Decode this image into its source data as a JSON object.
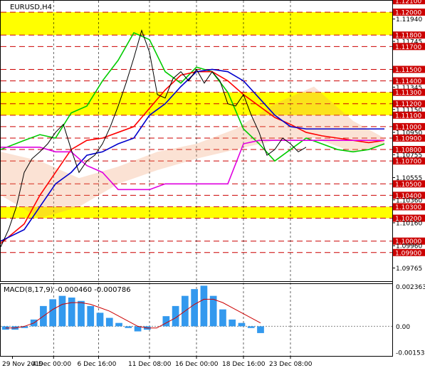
{
  "chart_data": [
    {
      "type": "line",
      "title": "EURUSD,H4",
      "ylim": [
        1.0965,
        1.121
      ],
      "y_ticks": [
        "1.12100",
        "1.12000",
        "1.11940",
        "1.11800",
        "1.11745",
        "1.11700",
        "1.11500",
        "1.11400",
        "1.11345",
        "1.11300",
        "1.11200",
        "1.11150",
        "1.11100",
        "1.11000",
        "1.10950",
        "1.10900",
        "1.10800",
        "1.10755",
        "1.10700",
        "1.10555",
        "1.10500",
        "1.10400",
        "1.10360",
        "1.10300",
        "1.10200",
        "1.10160",
        "1.10000",
        "1.09960",
        "1.09900",
        "1.09765"
      ],
      "highlighted_levels": [
        "1.12100",
        "1.12000",
        "1.11800",
        "1.11700",
        "1.11500",
        "1.11400",
        "1.11300",
        "1.11200",
        "1.11100",
        "1.11000",
        "1.10900",
        "1.10800",
        "1.10700",
        "1.10500",
        "1.10400",
        "1.10300",
        "1.10200",
        "1.10000",
        "1.09900"
      ],
      "yellow_zones": [
        [
          1.118,
          1.12
        ],
        [
          1.111,
          1.113
        ],
        [
          1.102,
          1.103
        ]
      ],
      "red_dashed_levels": [
        1.12,
        1.118,
        1.117,
        1.115,
        1.114,
        1.113,
        1.112,
        1.111,
        1.11,
        1.109,
        1.108,
        1.107,
        1.105,
        1.104,
        1.103,
        1.102,
        1.1,
        1.099
      ],
      "series": [
        {
          "color": "#00cc00",
          "x": [
            0,
            6,
            10,
            14,
            18,
            22,
            26,
            30,
            34,
            38,
            42,
            46,
            50,
            54,
            58,
            62,
            66,
            70,
            74,
            78,
            82,
            86,
            90,
            94,
            98
          ],
          "y": [
            1.108,
            1.1088,
            1.1093,
            1.109,
            1.1112,
            1.1118,
            1.114,
            1.1158,
            1.1182,
            1.1176,
            1.1148,
            1.1138,
            1.1152,
            1.1148,
            1.113,
            1.1098,
            1.1085,
            1.107,
            1.108,
            1.109,
            1.1085,
            1.108,
            1.1078,
            1.108,
            1.1085
          ]
        },
        {
          "color": "#ff0000",
          "x": [
            0,
            6,
            10,
            14,
            18,
            22,
            26,
            30,
            34,
            38,
            42,
            46,
            50,
            54,
            58,
            62,
            66,
            70,
            74,
            78,
            82,
            86,
            90,
            94,
            98
          ],
          "y": [
            1.0998,
            1.1015,
            1.104,
            1.106,
            1.108,
            1.1088,
            1.109,
            1.1095,
            1.11,
            1.1116,
            1.1132,
            1.1145,
            1.1148,
            1.1148,
            1.114,
            1.1128,
            1.1118,
            1.1108,
            1.1102,
            1.1095,
            1.1092,
            1.109,
            1.1088,
            1.1086,
            1.1088
          ]
        },
        {
          "color": "#0000cc",
          "x": [
            0,
            6,
            10,
            14,
            18,
            22,
            26,
            30,
            34,
            38,
            42,
            46,
            50,
            54,
            58,
            62,
            66,
            70,
            74,
            78,
            82,
            86,
            90,
            94,
            98
          ],
          "y": [
            1.1,
            1.101,
            1.103,
            1.105,
            1.106,
            1.1075,
            1.1078,
            1.1085,
            1.109,
            1.111,
            1.112,
            1.1135,
            1.1148,
            1.115,
            1.1148,
            1.114,
            1.1125,
            1.111,
            1.11,
            1.1098,
            1.1098,
            1.1098,
            1.1098,
            1.1098,
            1.1098
          ]
        },
        {
          "color": "#e000e0",
          "x": [
            0,
            6,
            10,
            14,
            18,
            22,
            26,
            30,
            34,
            38,
            42,
            46,
            50,
            54,
            58,
            62,
            66,
            70,
            74,
            78,
            82,
            86,
            90,
            94,
            98
          ],
          "y": [
            1.1082,
            1.1082,
            1.1082,
            1.1078,
            1.1078,
            1.1066,
            1.106,
            1.1045,
            1.1045,
            1.1045,
            1.105,
            1.105,
            1.105,
            1.105,
            1.105,
            1.1085,
            1.1088,
            1.1088,
            1.1088,
            1.1088,
            1.1088,
            1.1088,
            1.1088,
            1.1088,
            1.1088
          ]
        },
        {
          "color": "#000000",
          "x": [
            0,
            2,
            4,
            6,
            8,
            10,
            12,
            14,
            16,
            18,
            20,
            22,
            24,
            26,
            28,
            30,
            32,
            34,
            36,
            38,
            40,
            42,
            44,
            46,
            48,
            50,
            52,
            54,
            56,
            58,
            60,
            62,
            64,
            66,
            68,
            70,
            72,
            74,
            76,
            78
          ],
          "y": [
            1.0995,
            1.101,
            1.103,
            1.106,
            1.1072,
            1.1078,
            1.1085,
            1.1095,
            1.1102,
            1.108,
            1.106,
            1.107,
            1.1075,
            1.1085,
            1.11,
            1.1118,
            1.1138,
            1.116,
            1.1184,
            1.1165,
            1.1128,
            1.1125,
            1.1142,
            1.1148,
            1.114,
            1.115,
            1.1138,
            1.1148,
            1.114,
            1.112,
            1.1118,
            1.1128,
            1.111,
            1.1095,
            1.1075,
            1.108,
            1.109,
            1.1085,
            1.1078,
            1.1082
          ]
        }
      ]
    },
    {
      "type": "bar",
      "title": "MACD(8,17,9) -0.000460 -0.000786",
      "ylim": [
        -0.00175,
        0.0025
      ],
      "y_ticks": [
        "0.002363",
        "0.00",
        "-0.001538"
      ],
      "values": [
        -0.0002,
        -0.0002,
        -0.0001,
        0.0004,
        0.0012,
        0.0016,
        0.0018,
        0.0017,
        0.0015,
        0.0012,
        0.0008,
        0.0005,
        0.0002,
        -0.0001,
        -0.0003,
        -0.0002,
        0.0,
        0.0006,
        0.0012,
        0.0018,
        0.0022,
        0.0024,
        0.0018,
        0.001,
        0.0004,
        0.0002,
        -0.0001,
        -0.0004,
        -0.0008,
        -0.0012,
        -0.0014,
        -0.0012,
        -0.0008,
        -0.0005
      ],
      "signal": [
        -0.0001,
        -0.0001,
        0.0,
        0.0002,
        0.0006,
        0.001,
        0.0013,
        0.0014,
        0.0014,
        0.0013,
        0.0011,
        0.0009,
        0.0006,
        0.0003,
        0.0,
        -0.0001,
        -0.0001,
        0.0002,
        0.0005,
        0.0009,
        0.0013,
        0.0016,
        0.0016,
        0.0014,
        0.0011,
        0.0008,
        0.0005,
        0.0002,
        -0.0002,
        -0.0005,
        -0.0008,
        -0.0009,
        -0.0009,
        -0.0008
      ]
    }
  ],
  "x_axis": {
    "labels": [
      "29 Nov 2019",
      "4 Dec 00:00",
      "6 Dec 16:00",
      "11 Dec 08:00",
      "16 Dec 00:00",
      "18 Dec 16:00",
      "23 Dec 08:00"
    ]
  }
}
